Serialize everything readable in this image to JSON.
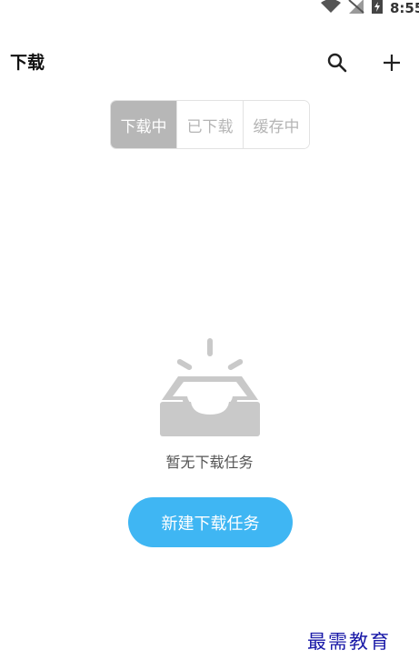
{
  "status_bar": {
    "time": "8:55",
    "icons": [
      "wifi-icon",
      "no-signal-icon",
      "battery-charging-icon"
    ]
  },
  "header": {
    "title": "下载",
    "actions": [
      "search-icon",
      "add-icon"
    ]
  },
  "tabs": [
    {
      "label": "下载中",
      "active": true
    },
    {
      "label": "已下载",
      "active": false
    },
    {
      "label": "缓存中",
      "active": false
    }
  ],
  "empty_state": {
    "icon": "empty-inbox-icon",
    "message": "暂无下载任务",
    "button_label": "新建下载任务"
  },
  "watermark": "最需教育",
  "colors": {
    "accent": "#3fb6f3",
    "tab_active_bg": "#b7b7b7",
    "watermark": "#1a1aa8"
  }
}
